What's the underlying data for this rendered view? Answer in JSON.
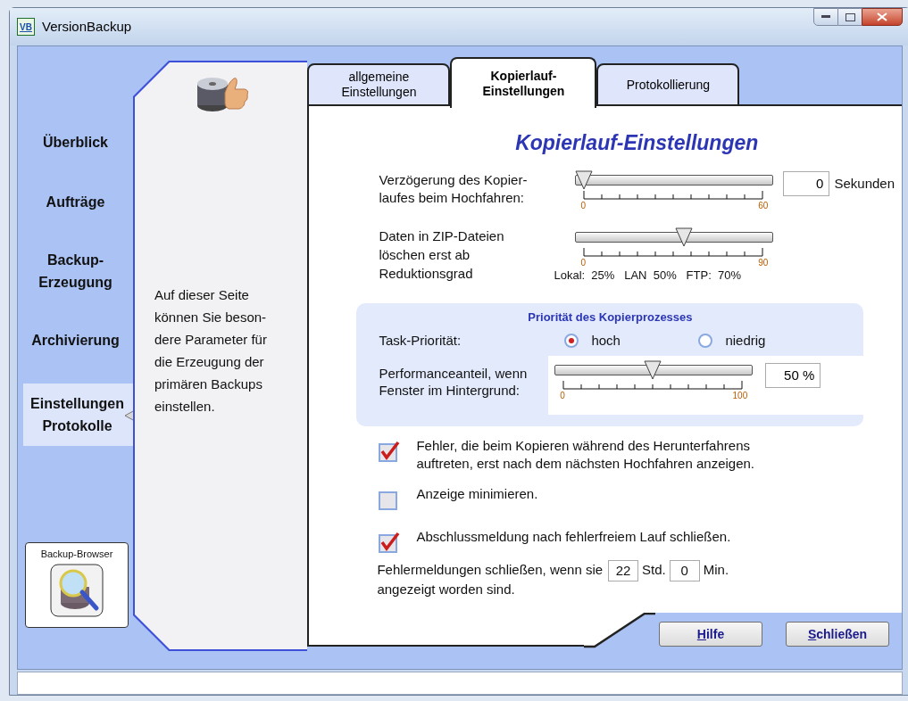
{
  "window": {
    "title": "VersionBackup",
    "icon_text": "VB"
  },
  "nav": [
    {
      "label": "Überblick",
      "selected": false
    },
    {
      "label": "Aufträge",
      "selected": false
    },
    {
      "label": "Backup-\nErzeugung",
      "selected": false
    },
    {
      "label": "Archivierung",
      "selected": false
    },
    {
      "label": "Einstellungen\nProtokolle",
      "selected": true
    }
  ],
  "backup_browser": {
    "label": "Backup-Browser"
  },
  "description": "Auf dieser Seite\nkönnen Sie beson-\ndere Parameter für\ndie Erzeugung der\nprimären Backups\neinstellen.",
  "tabs": [
    {
      "label": "allgemeine\nEinstellungen",
      "selected": false
    },
    {
      "label": "Kopierlauf-\nEinstellungen",
      "selected": true
    },
    {
      "label": "Protokollierung",
      "selected": false
    }
  ],
  "heading": "Kopierlauf-Einstellungen",
  "delay": {
    "label": "Verzögerung des Kopier-\nlaufes beim Hochfahren:",
    "level": 0,
    "min": "0",
    "max": "60",
    "value": "0",
    "unit": "Sekunden"
  },
  "zip": {
    "label": "Daten in ZIP-Dateien\nlöschen erst ab\nReduktionsgrad",
    "level": 0.56,
    "min": "0",
    "max": "90",
    "presets": "Lokal:  25%   LAN  50%   FTP:  70%"
  },
  "priority": {
    "title": "Priorität des Kopierprozesses",
    "task_label": "Task-Priorität:",
    "options": [
      {
        "label": "hoch",
        "selected": true
      },
      {
        "label": "niedrig",
        "selected": false
      }
    ],
    "performance": {
      "label": "Performanceanteil, wenn\nFenster im Hintergrund:",
      "level": 0.5,
      "min": "0",
      "max": "100",
      "value": "50 %"
    }
  },
  "checkboxes": [
    {
      "label": "Fehler, die beim Kopieren während des Herunterfahrens\nauftreten, erst nach dem nächsten Hochfahren anzeigen.",
      "checked": true
    },
    {
      "label": "Anzeige minimieren.",
      "checked": false
    },
    {
      "label": "Abschlussmeldung nach fehlerfreiem Lauf schließen.",
      "checked": true
    }
  ],
  "close_errors": {
    "prefix": "Fehlermeldungen schließen, wenn sie",
    "hours": "22",
    "hours_unit": "Std.",
    "minutes": "0",
    "minutes_unit": "Min.",
    "suffix": "angezeigt worden sind."
  },
  "buttons": [
    {
      "label": "Hilfe"
    },
    {
      "label": "Schließen"
    }
  ]
}
